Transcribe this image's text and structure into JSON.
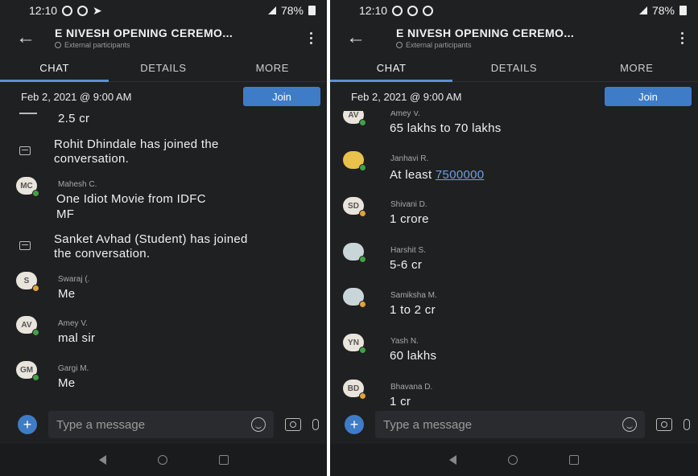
{
  "left": {
    "status": {
      "time": "12:10",
      "battery": "78%"
    },
    "header": {
      "title": "E NIVESH OPENING CEREMO...",
      "subtitle": "External participants"
    },
    "tabs": [
      "CHAT",
      "DETAILS",
      "MORE"
    ],
    "meeting": {
      "time": "Feb 2, 2021 @ 9:00 AM",
      "join_label": "Join"
    },
    "messages": [
      {
        "type": "fragment",
        "text": "2.5 cr"
      },
      {
        "type": "system",
        "line1": "Rohit Dhindale has joined the",
        "line2": "conversation."
      },
      {
        "type": "chat",
        "initials": "MC",
        "sender": "Mahesh C.",
        "line1": "One Idiot Movie from IDFC",
        "line2": "MF"
      },
      {
        "type": "system",
        "line1": "Sanket Avhad (Student) has joined",
        "line2": "the conversation."
      },
      {
        "type": "chat",
        "initials": "S",
        "sender": "Swaraj (.",
        "line1": "Me"
      },
      {
        "type": "chat",
        "initials": "AV",
        "sender": "Amey V.",
        "line1": "mal sir"
      },
      {
        "type": "chat",
        "initials": "GM",
        "sender": "Gargi M.",
        "line1": "Me"
      }
    ],
    "composer": {
      "placeholder": "Type a message"
    }
  },
  "right": {
    "status": {
      "time": "12:10",
      "battery": "78%"
    },
    "header": {
      "title": "E NIVESH OPENING CEREMO...",
      "subtitle": "External participants"
    },
    "tabs": [
      "CHAT",
      "DETAILS",
      "MORE"
    ],
    "meeting": {
      "time": "Feb 2, 2021 @ 9:00 AM",
      "join_label": "Join"
    },
    "messages": [
      {
        "initials": "AV",
        "sender": "Amey V.",
        "text": "65 lakhs to 70 lakhs"
      },
      {
        "initials": "",
        "sender": "Janhavi R.",
        "text_prefix": "At least ",
        "link": "7500000"
      },
      {
        "initials": "SD",
        "sender": "Shivani D.",
        "text": "1 crore"
      },
      {
        "initials": "",
        "sender": "Harshit S.",
        "text": "5-6 cr"
      },
      {
        "initials": "",
        "sender": "Samiksha M.",
        "text": "1 to 2 cr"
      },
      {
        "initials": "YN",
        "sender": "Yash N.",
        "text": "60 lakhs"
      },
      {
        "initials": "BD",
        "sender": "Bhavana D.",
        "text": "1 cr"
      }
    ],
    "composer": {
      "placeholder": "Type a message"
    }
  },
  "colors": {
    "background": "#1f2022",
    "accent": "#3e7cc8",
    "link": "#6ea0df"
  }
}
